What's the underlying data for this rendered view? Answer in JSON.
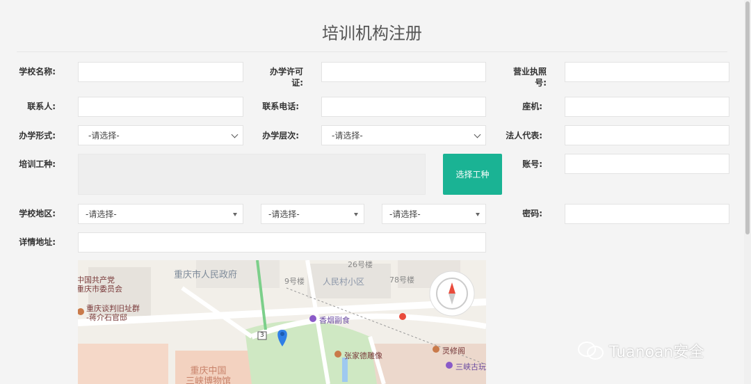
{
  "title": "培训机构注册",
  "labels": {
    "school_name": "学校名称:",
    "license": "办学许可\n证:",
    "business_license": "营业执照\n号:",
    "contact": "联系人:",
    "phone": "联系电话:",
    "landline": "座机:",
    "school_form": "办学形式:",
    "school_level": "办学层次:",
    "legal_rep": "法人代表:",
    "training_type": "培训工种:",
    "account": "账号:",
    "region": "学校地区:",
    "password": "密码:",
    "address": "详情地址:"
  },
  "placeholder_select": "-请选择-",
  "select_button": "选择工种",
  "map_labels": {
    "gov": "重庆市人民政府",
    "b26": "26号楼",
    "b9": "9号楼",
    "village": "人民村小区",
    "b78": "78号楼",
    "cpc": "中国共产党\n重庆市委员会",
    "site": "重庆谈判旧址群\n-蒋介石官邸",
    "shop": "香烟副食",
    "ling": "灵修阁",
    "statue": "张家德雕像",
    "sanxia": "三峡古玩",
    "museum": "重庆中国\n三峡博物馆",
    "route": "3"
  },
  "watermark": "Tuanoan安全"
}
